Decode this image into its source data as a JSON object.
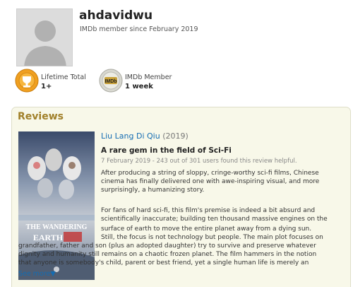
{
  "profile": {
    "username": "ahdavidwu",
    "member_since": "IMDb member since February 2019"
  },
  "badges": [
    {
      "title": "Lifetime Total",
      "value": "1+",
      "icon": "trophy-medal-icon",
      "color": "#f0a020"
    },
    {
      "title": "IMDb Member",
      "value": "1 week",
      "icon": "imdb-medal-icon",
      "color": "#c8c8c0"
    }
  ],
  "reviews": {
    "heading": "Reviews",
    "items": [
      {
        "poster_text": {
          "line1": "THE WANDERING",
          "line2": "EARTH"
        },
        "film_title": "Liu Lang Di Qiu",
        "film_year": "(2019)",
        "review_title": "A rare gem in the field of Sci-Fi",
        "meta": "7 February 2019 - 243 out of 301 users found this review helpful.",
        "para1_lines": [
          "After producing a string of sloppy, cringe-worthy sci-fi films, Chinese",
          "cinema has finally delivered one with awe-inspiring visual, and more",
          "surprisingly, a humanizing story."
        ],
        "para2_lines": [
          "For fans of hard sci-fi, this film's premise is indeed a bit absurd and",
          "scientifically inaccurate; building ten thousand massive engines on the"
        ],
        "para3_lines": [
          "surface of earth to move the entire planet away from a dying sun.",
          "Still, the focus is not technology but people. The main plot focuses on",
          "grandfather, father and son (plus an adopted daughter) try to survive and preserve whatever",
          "dignity and humanity still remains on a chaotic frozen planet. The film hammers in the notion",
          "that anyone is somebody's child, parent or best friend, yet a single human life is merely an"
        ],
        "see_more": "See more▼"
      }
    ]
  },
  "colors": {
    "accent_heading": "#a1802a",
    "link": "#136cb2",
    "box_bg": "#f8f8e9"
  }
}
